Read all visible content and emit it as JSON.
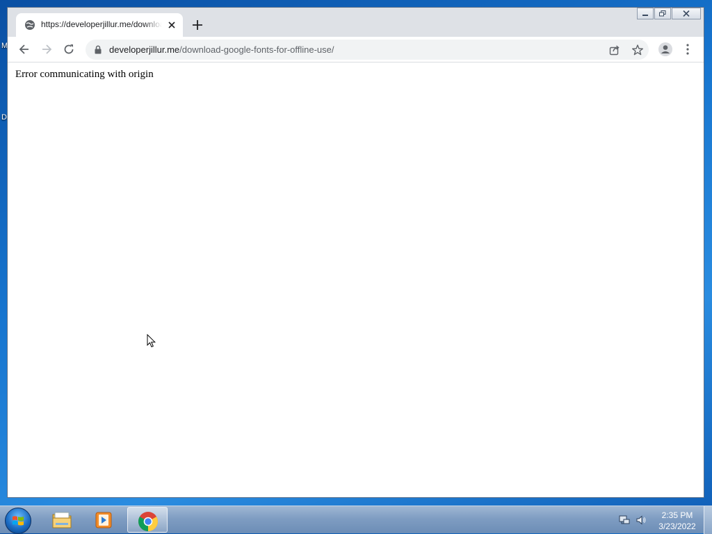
{
  "desktop": {
    "fragments": [
      "M",
      "D"
    ]
  },
  "browser": {
    "tab": {
      "title": "https://developerjillur.me/download-google-fonts-for-offline-use/"
    },
    "address": {
      "host": "developerjillur.me",
      "path": "/download-google-fonts-for-offline-use/"
    },
    "page": {
      "message": "Error communicating with origin"
    }
  },
  "taskbar": {
    "items": [
      "windows-explorer-icon",
      "media-player-icon",
      "chrome-icon"
    ],
    "clock": {
      "time": "2:35 PM",
      "date": "3/23/2022"
    }
  },
  "colors": {
    "tabstrip": "#dee1e6",
    "omnibox": "#f1f3f4",
    "taskbar": "#7f9dc2"
  }
}
